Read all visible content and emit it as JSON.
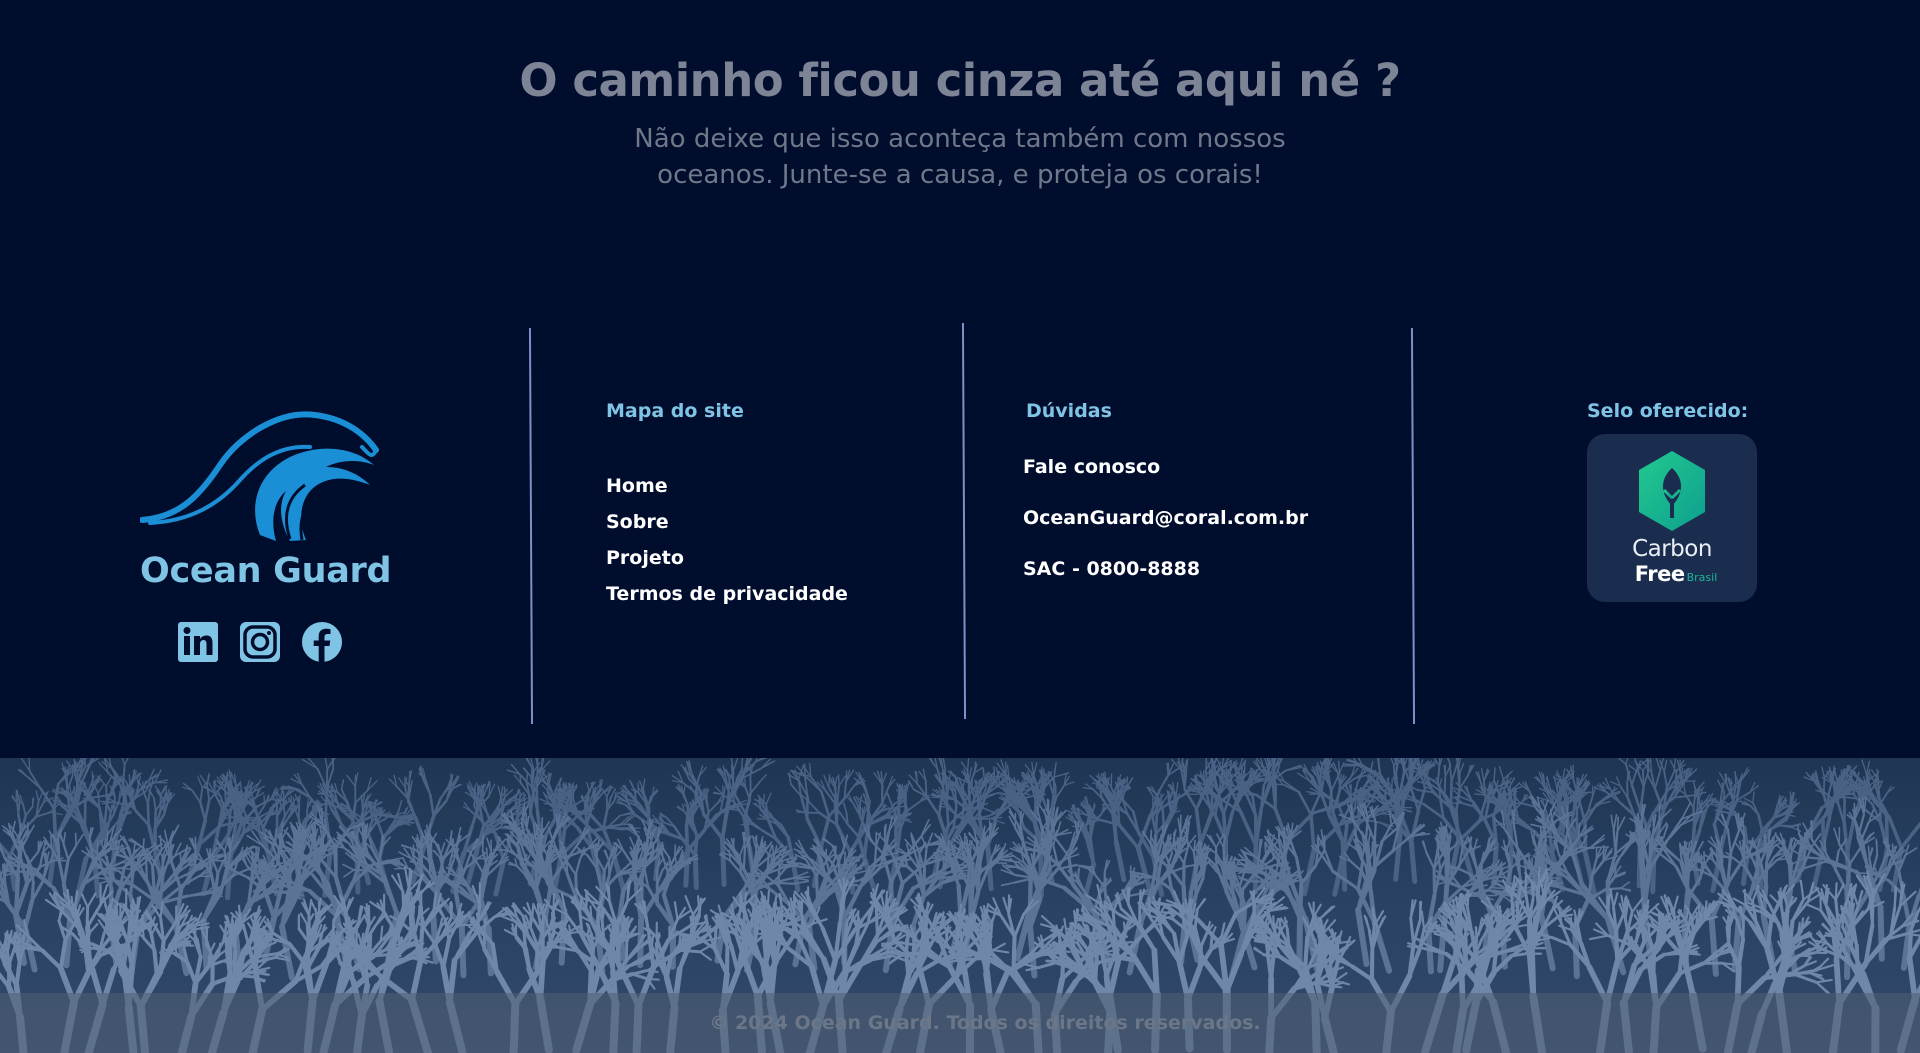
{
  "hero": {
    "title": "O caminho ficou cinza até aqui né ?",
    "subtitle": "Não deixe que isso aconteça também com nossos oceanos. Junte-se a causa, e proteja os corais!"
  },
  "brand": {
    "name": "Ocean Guard",
    "logo_icon": "wave-icon",
    "socials": [
      {
        "name": "linkedin",
        "icon": "linkedin-icon"
      },
      {
        "name": "instagram",
        "icon": "instagram-icon"
      },
      {
        "name": "facebook",
        "icon": "facebook-icon"
      }
    ]
  },
  "sitemap": {
    "title": "Mapa do site",
    "items": [
      "Home",
      "Sobre",
      "Projeto",
      "Termos de privacidade"
    ]
  },
  "help": {
    "title": "Dúvidas",
    "items": [
      "Fale conosco",
      "OceanGuard@coral.com.br",
      "SAC - 0800-8888"
    ]
  },
  "seal": {
    "title": "Selo oferecido:",
    "badge_word1": "Carbon",
    "badge_word2": "Free",
    "badge_word3": "Brasil"
  },
  "footer": {
    "copyright": "© 2024 Ocean Guard. Todos os direitos reservados."
  },
  "colors": {
    "background": "#010d2d",
    "accent": "#7fc4e4",
    "logo_blue": "#1a8fd6",
    "seal_green": "#1eb59a",
    "divider": "#7f8fc7"
  }
}
